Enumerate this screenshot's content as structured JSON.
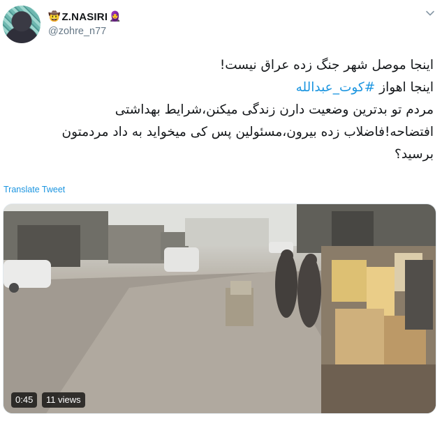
{
  "author": {
    "emoji_left": "🤠",
    "display_name": "Z.NASIRI",
    "emoji_right": "🧕",
    "handle": "@zohre_n77"
  },
  "icons": {
    "menu": "chevron-down-icon"
  },
  "tweet": {
    "line1": "اینجا موصل شهر جنگ زده عراق نیست!",
    "line2_prefix": "اینجا اهواز ",
    "hashtag": "#کوت_عبدالله",
    "line3": "مردم تو بدترین وضعیت دارن زندگی میکنن،شرایط بهداشتی",
    "line4": "افتضاحه!فاضلاب زده بیرون،مسئولین پس کی میخواید به داد مردمتون",
    "line5": "برسید؟"
  },
  "translate_label": "Translate Tweet",
  "video": {
    "duration": "0:45",
    "views": "11 views"
  },
  "colors": {
    "accent": "#1b95e0",
    "muted": "#657786",
    "text": "#14171a"
  }
}
